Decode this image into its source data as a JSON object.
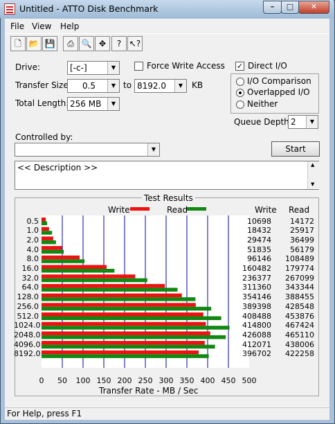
{
  "window": {
    "title": "Untitled - ATTO Disk Benchmark"
  },
  "menu": {
    "items": [
      "File",
      "View",
      "Help"
    ]
  },
  "toolbar": {
    "icons": [
      "new-icon",
      "open-icon",
      "save-icon",
      "print-icon",
      "print-preview-icon",
      "move-icon",
      "help-icon",
      "context-help-icon"
    ]
  },
  "form": {
    "drive_label": "Drive:",
    "drive_value": "[-c-]",
    "force_write_label": "Force Write Access",
    "force_write_checked": false,
    "direct_io_label": "Direct I/O",
    "direct_io_checked": true,
    "transfer_size_label": "Transfer Size:",
    "transfer_from": "0.5",
    "to_label": "to",
    "transfer_to": "8192.0",
    "kb_label": "KB",
    "total_length_label": "Total Length:",
    "total_length_value": "256 MB",
    "io_options": [
      {
        "label": "I/O Comparison",
        "selected": false
      },
      {
        "label": "Overlapped I/O",
        "selected": true
      },
      {
        "label": "Neither",
        "selected": false
      }
    ],
    "queue_depth_label": "Queue Depth:",
    "queue_depth_value": "2",
    "controlled_by_label": "Controlled by:",
    "controlled_by_value": "",
    "start_label": "Start",
    "description": "<< Description >>"
  },
  "results": {
    "title": "Test Results",
    "write_legend": "Write",
    "read_legend": "Read",
    "write_col": "Write",
    "read_col": "Read"
  },
  "chart_data": {
    "type": "bar",
    "orientation": "horizontal",
    "title": "",
    "xlabel": "Transfer Rate - MB / Sec",
    "ylabel": "",
    "xlim": [
      0,
      500
    ],
    "xticks": [
      "0",
      "50",
      "100",
      "150",
      "200",
      "250",
      "300",
      "350",
      "400",
      "450",
      "500"
    ],
    "categories": [
      "0.5",
      "1.0",
      "2.0",
      "4.0",
      "8.0",
      "16.0",
      "32.0",
      "64.0",
      "128.0",
      "256.0",
      "512.0",
      "1024.0",
      "2048.0",
      "4096.0",
      "8192.0"
    ],
    "series": [
      {
        "name": "Write",
        "color": "#ee1111",
        "values": [
          10.2,
          18.0,
          28.1,
          49.4,
          91.7,
          156.7,
          225.5,
          296.9,
          337.9,
          371.4,
          389.6,
          395.6,
          406.3,
          393.0,
          378.3
        ]
      },
      {
        "name": "Read",
        "color": "#118811",
        "values": [
          13.5,
          25.3,
          34.8,
          53.6,
          103.5,
          175.6,
          254.8,
          327.5,
          370.6,
          408.5,
          432.7,
          452.6,
          443.6,
          417.7,
          402.7
        ]
      }
    ],
    "write_text": [
      "10698",
      "18432",
      "29474",
      "51835",
      "96146",
      "160482",
      "236377",
      "311360",
      "354146",
      "389398",
      "408488",
      "414800",
      "426088",
      "412071",
      "396702"
    ],
    "read_text": [
      "14172",
      "25917",
      "36499",
      "56179",
      "108489",
      "179774",
      "267099",
      "343344",
      "388455",
      "428548",
      "453876",
      "467424",
      "465110",
      "438006",
      "422258"
    ],
    "grid": true
  },
  "status": {
    "text": "For Help, press F1"
  },
  "colors": {
    "write": "#ee1111",
    "read": "#118811",
    "grid": "#0000aa"
  }
}
